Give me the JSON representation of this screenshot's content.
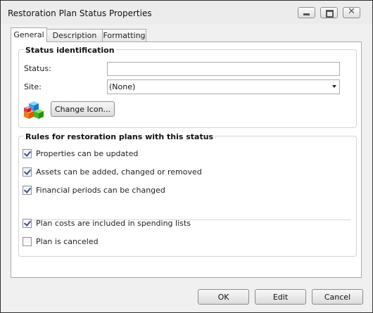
{
  "window": {
    "title": "Restoration Plan Status Properties",
    "controls": {
      "minimize": "minimize-icon",
      "maximize": "maximize-icon",
      "close": "✕"
    }
  },
  "tabs": [
    {
      "label": "General",
      "active": true
    },
    {
      "label": "Description",
      "active": false
    },
    {
      "label": "Formatting",
      "active": false
    }
  ],
  "identification": {
    "heading": "Status identification",
    "status_label": "Status:",
    "status_value": "",
    "site_label": "Site:",
    "site_value": "(None)",
    "icon": "stacked-cubes-icon",
    "change_icon_label": "Change Icon..."
  },
  "rules": {
    "heading": "Rules for restoration plans with this status",
    "items": [
      {
        "label": "Properties can be updated",
        "checked": true
      },
      {
        "label": "Assets can be added, changed or removed",
        "checked": true
      },
      {
        "label": "Financial periods can be changed",
        "checked": true
      },
      {
        "label": "Plan costs are included in spending lists",
        "checked": true
      },
      {
        "label": "Plan is canceled",
        "checked": false
      }
    ]
  },
  "footer": {
    "ok_label": "OK",
    "edit_label": "Edit",
    "cancel_label": "Cancel"
  },
  "colors": {
    "window_bg": "#f0f0f0",
    "panel_bg": "#ffffff",
    "border": "#a9a9a9",
    "check": "#3b4f8f"
  }
}
